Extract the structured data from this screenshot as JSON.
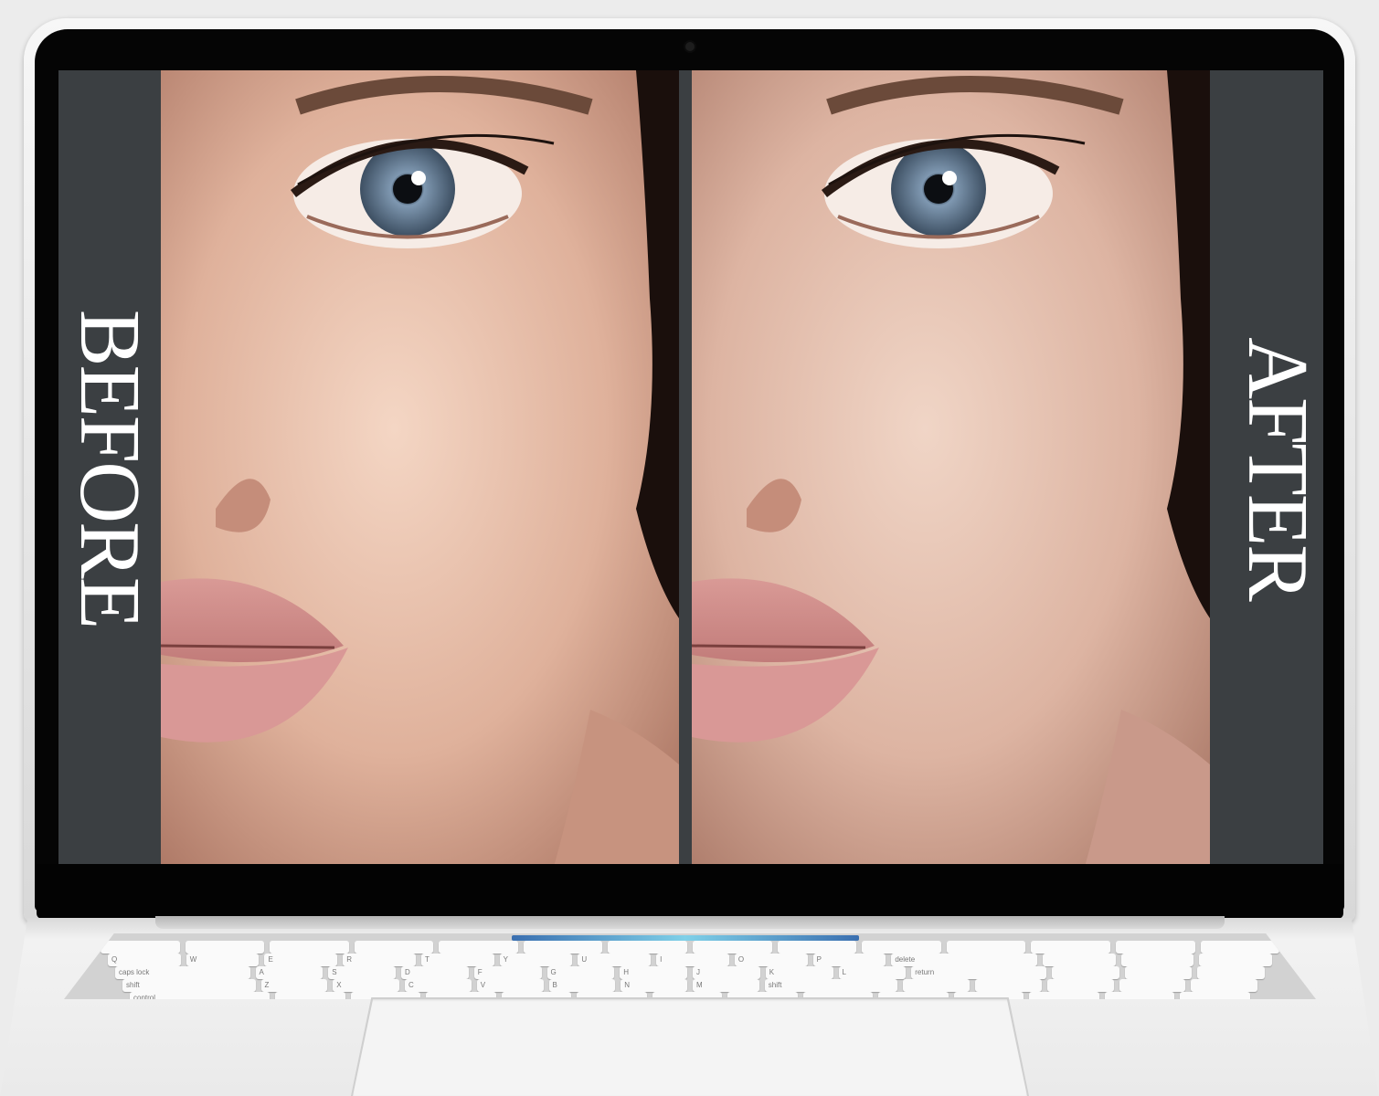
{
  "labels": {
    "before": "BEFORE",
    "after": "AFTER"
  },
  "keyboard": {
    "rows": [
      [],
      [
        "Q",
        "W",
        "E",
        "R",
        "T",
        "Y",
        "U",
        "I",
        "O",
        "P",
        "delete"
      ],
      [
        "caps lock",
        "A",
        "S",
        "D",
        "F",
        "G",
        "H",
        "J",
        "K",
        "L",
        "return"
      ],
      [
        "shift",
        "Z",
        "X",
        "C",
        "V",
        "B",
        "N",
        "M",
        "shift"
      ],
      [
        "control",
        "",
        "",
        "",
        "",
        "",
        ""
      ]
    ]
  },
  "colors": {
    "screen_background": "#3b3f42",
    "label_text": "#ffffff"
  },
  "icons": {
    "camera": "webcam-icon"
  }
}
